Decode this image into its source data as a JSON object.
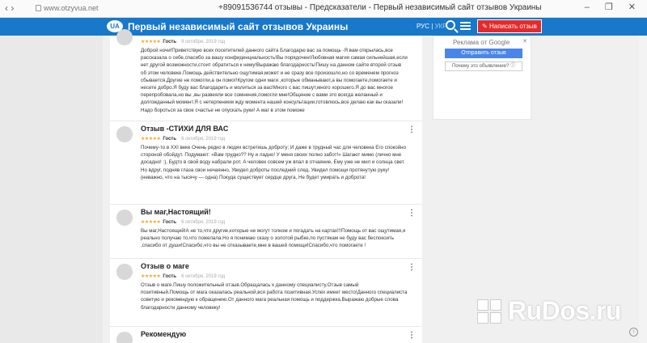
{
  "browser": {
    "url": "www.otzyvua.net",
    "tab_title": "+89091536744 отзывы - Предсказатели - Первый независимый сайт отзывов Украины",
    "window_controls": "– ❐ ✕",
    "back_glyph": "‹ ›"
  },
  "header": {
    "logo": "UA",
    "site_title": "Первый независимый сайт отзывов Украины",
    "lang_active": "РУС",
    "lang_sep": " | ",
    "lang_alt": "УКР",
    "write_button": "✎ Написать отзыв"
  },
  "reviews": [
    {
      "title": "",
      "stars": "★★★★★",
      "author": "Гость",
      "date": "9 октября, 2019 год",
      "body": "Доброй ночи!Приветствую всех посетителей данного сайта Благодарю вас за помощь -Я вам открылась,все рассказала о себе,спасибо за вашу конфиденциальность!Вы порядочен!Любовная магия самая сильнейшая,если нет другой возможности,стоит обратиться к нему!Выражаю благодарность!Пишу на данном сайте второй отзыв об этом человеке.Помощь действительно ощутимая,может и не сразу все произошло,но со временем прогноз сбывается.Другие не помогли,а он помог!Кругом одни маги ,которые обманывают,а вы помогаете,помогаете и несете добро.Я буду вас благодарить и молиться за вас!Много с вас пишут,много хорошего.Я до вас многое перепробовала,но вы ,вы развеяли все сомнения,помогли мне!Общение с вами это всегда желанный и долгожданный момент.Я с нетерпением жду момента нашей консультации,готовлюсь,все делаю как вы сказали!Надо бороться за свое счастье не опускать руки! А маг в этом поможе"
    },
    {
      "title": "Отзыв -СТИХИ ДЛЯ ВАС",
      "stars": "★★★★★",
      "author": "Гость",
      "date": "6 октября, 2019 год",
      "body": "Почему-то в XXI веке Очень редко в людях встретишь доброту; И даже в трудный час для человека Его спокойно стороной обойдут. Подумают: «Вам трудно?? Ну и ладно! У меня своих полно забот!» Шагают мимо (лично мне досадно! :), Будто в свой воду набрали рот. А человек совсем уж впал в отчаяние, Ему уже не мил и солнца свет. Но вдруг, подняв глаза свои нечаянно, Увидел доброты последний след. Увидел помощи протянутую руку! (неважно, что на тысячу — одна) Покуда существует сердце друга, Не будет умирать и доброта!"
    },
    {
      "title": "Вы маг,Настоящий!",
      "stars": "★★★★★",
      "author": "Гость",
      "date": "6 октября, 2019 год",
      "body": "Вы маг,Настоящий!А не то,что другие,которые не могут толком и погадать на картах!!!Помощь от вас ощутимая,я реально получаю то,что пожелала.Но я понимаю сказу о золотой рыбке,по пустякам не буду вас беспокоить ,спасибо от души!Спасибо,что вы не отказываете,мне в вашей помощи!Спасибо,что помогаете !"
    },
    {
      "title": "Отзыв о маге",
      "stars": "★★★★★",
      "author": "Гость",
      "date": "6 октября, 2019 год",
      "body": "Отзыв о маге.Пишу положительный отзыв.Обращалась к данному специалисту.Отзыв самый позитивный.Помощь от мага оказалась реальной,вся работа позитивная.Успех имеет место!Данного специалиста советую и рекомендую к обращению.От данного мага реальная помощь и поддержка.Выражаю добрые слова благодарности данному человеку!"
    },
    {
      "title": "Рекомендую",
      "stars": "★★★★★",
      "author": "",
      "date": "",
      "body": ""
    }
  ],
  "kebab": "⋮",
  "ad": {
    "close": "✕",
    "label": "Реклама от Google",
    "send_button": "Отправить отзыв",
    "why_button": "Почему это объявление? ⓘ"
  },
  "scroll_top": "↑",
  "watermark": "RuDos.ru"
}
